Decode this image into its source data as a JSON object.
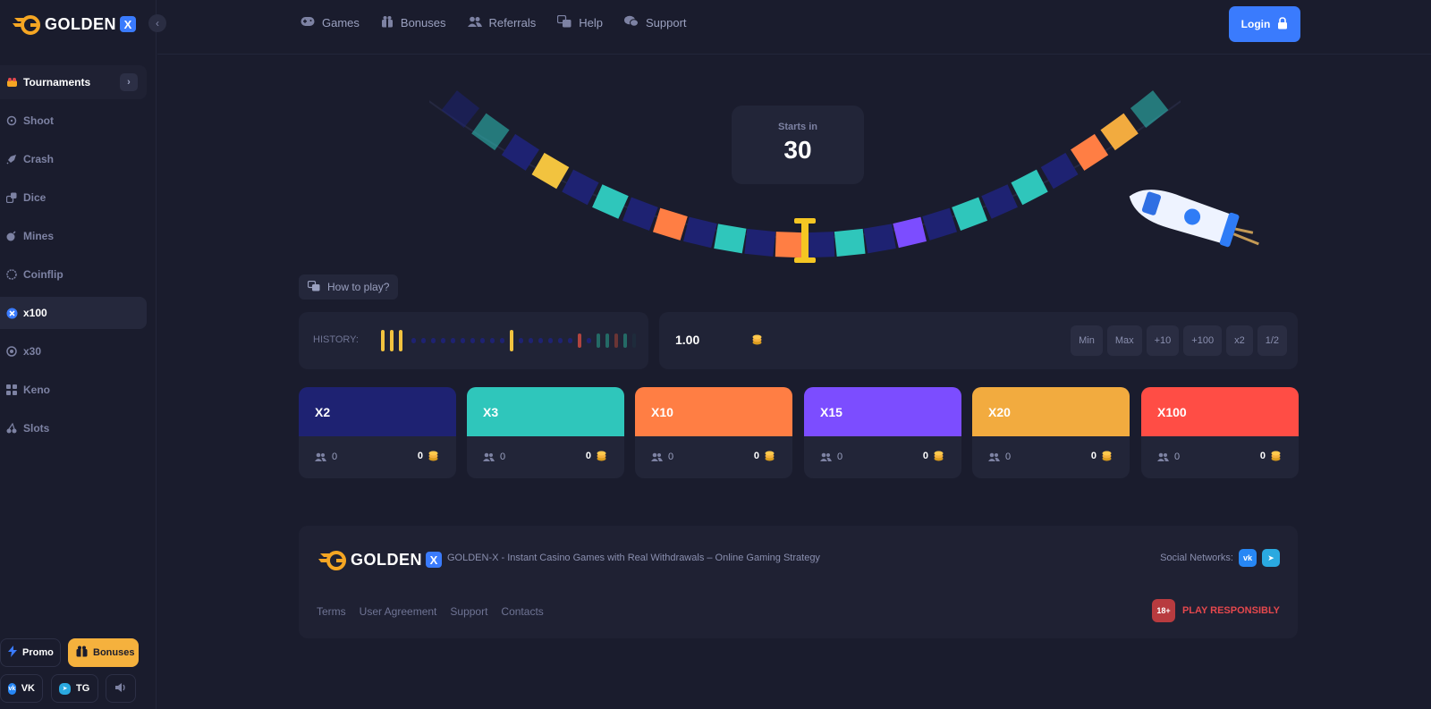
{
  "brand": {
    "name": "GOLDEN",
    "x_badge": "X"
  },
  "sidebar": {
    "items": [
      {
        "label": "Tournaments",
        "icon": "trophy-icon"
      },
      {
        "label": "Shoot",
        "icon": "crosshair-icon"
      },
      {
        "label": "Crash",
        "icon": "rocket-icon"
      },
      {
        "label": "Dice",
        "icon": "dice-icon"
      },
      {
        "label": "Mines",
        "icon": "bomb-icon"
      },
      {
        "label": "Coinflip",
        "icon": "coin-icon"
      },
      {
        "label": "x100",
        "icon": "x100-icon"
      },
      {
        "label": "x30",
        "icon": "x30-icon"
      },
      {
        "label": "Keno",
        "icon": "grid-icon"
      },
      {
        "label": "Slots",
        "icon": "cherry-icon"
      }
    ],
    "active": "x100",
    "promo_label": "Promo",
    "bonuses_label": "Bonuses",
    "vk_label": "VK",
    "tg_label": "TG"
  },
  "topnav": {
    "items": [
      {
        "label": "Games",
        "icon": "gamepad-icon"
      },
      {
        "label": "Bonuses",
        "icon": "gift-icon"
      },
      {
        "label": "Referrals",
        "icon": "users-icon"
      },
      {
        "label": "Help",
        "icon": "help-icon"
      },
      {
        "label": "Support",
        "icon": "chat-icon"
      }
    ],
    "login_label": "Login"
  },
  "game": {
    "starts_label": "Starts in",
    "countdown": "30",
    "how_to_play": "How to play?"
  },
  "history": {
    "label": "HISTORY:"
  },
  "bet": {
    "amount": "1.00",
    "buttons": [
      "Min",
      "Max",
      "+10",
      "+100",
      "x2",
      "1/2"
    ]
  },
  "multipliers": [
    {
      "label": "X2",
      "color": "#1e2272",
      "players": "0",
      "amount": "0"
    },
    {
      "label": "X3",
      "color": "#2fc6bb",
      "players": "0",
      "amount": "0"
    },
    {
      "label": "X10",
      "color": "#ff7e44",
      "players": "0",
      "amount": "0"
    },
    {
      "label": "X15",
      "color": "#7c4dff",
      "players": "0",
      "amount": "0"
    },
    {
      "label": "X20",
      "color": "#f2ab3f",
      "players": "0",
      "amount": "0"
    },
    {
      "label": "X100",
      "color": "#ff4d45",
      "players": "0",
      "amount": "0"
    }
  ],
  "footer": {
    "tagline": "GOLDEN-X - Instant Casino Games with Real Withdrawals – Online Gaming Strategy",
    "social_label": "Social Networks:",
    "links": [
      "Terms",
      "User Agreement",
      "Support",
      "Contacts"
    ],
    "age": "18+",
    "responsible": "PLAY RESPONSIBLY"
  },
  "colors": {
    "accent": "#3a7bfd",
    "gold": "#f5b13d",
    "bg": "#1a1c2d",
    "panel": "#202336"
  }
}
